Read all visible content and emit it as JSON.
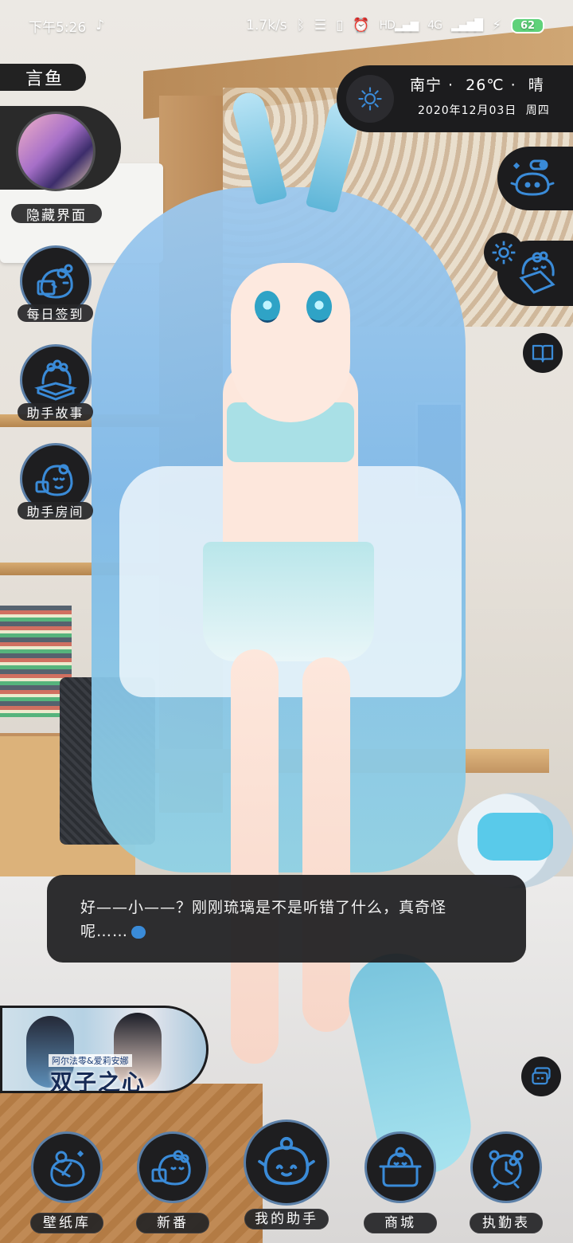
{
  "status_bar": {
    "time": "下午5:26",
    "speed": "1.7k/s",
    "net": "4G",
    "hd": "HD",
    "battery": "62"
  },
  "app": {
    "name": "言鱼"
  },
  "left_menu": {
    "hidden_ui": "隐藏界面",
    "checkin": "每日签到",
    "story": "助手故事",
    "room": "助手房间"
  },
  "weather": {
    "city": "南宁",
    "temperature": "26℃",
    "condition": "晴",
    "date": "2020年12月03日",
    "weekday": "周四"
  },
  "dialog": {
    "text": "好——小——？刚刚琉璃是不是听错了什么，真奇怪呢……"
  },
  "banner": {
    "subtitle": "阿尔法零&爱莉安娜",
    "title": "双子之心"
  },
  "bottom_nav": {
    "wallpaper": "壁纸库",
    "new": "新番",
    "assistant": "我的助手",
    "shop": "商城",
    "duty": "执勤表"
  },
  "colors": {
    "icon_blue": "#3a8bd8",
    "panel": "#1c1c1e",
    "ring": "#5c80a8",
    "battery": "#5fd27a"
  },
  "icons": [
    "music-note-icon",
    "bluetooth-icon",
    "menu-icon",
    "vibrate-icon",
    "alarm-icon",
    "signal-icon",
    "charging-icon",
    "sun-icon",
    "gear-icon",
    "book-icon",
    "chat-icon"
  ]
}
